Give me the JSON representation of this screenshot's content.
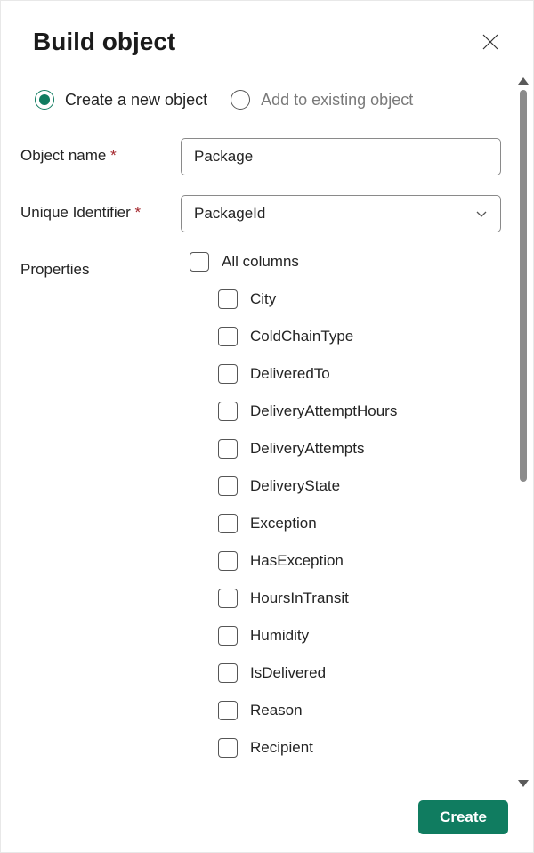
{
  "header": {
    "title": "Build object"
  },
  "mode": {
    "create_label": "Create a new object",
    "add_label": "Add to existing object",
    "selected": "create"
  },
  "fields": {
    "name_label": "Object name",
    "name_value": "Package",
    "id_label": "Unique Identifier",
    "id_value": "PackageId",
    "props_label": "Properties"
  },
  "properties": {
    "all_label": "All columns",
    "items": [
      "City",
      "ColdChainType",
      "DeliveredTo",
      "DeliveryAttemptHours",
      "DeliveryAttempts",
      "DeliveryState",
      "Exception",
      "HasException",
      "HoursInTransit",
      "Humidity",
      "IsDelivered",
      "Reason",
      "Recipient"
    ]
  },
  "footer": {
    "create_label": "Create"
  }
}
